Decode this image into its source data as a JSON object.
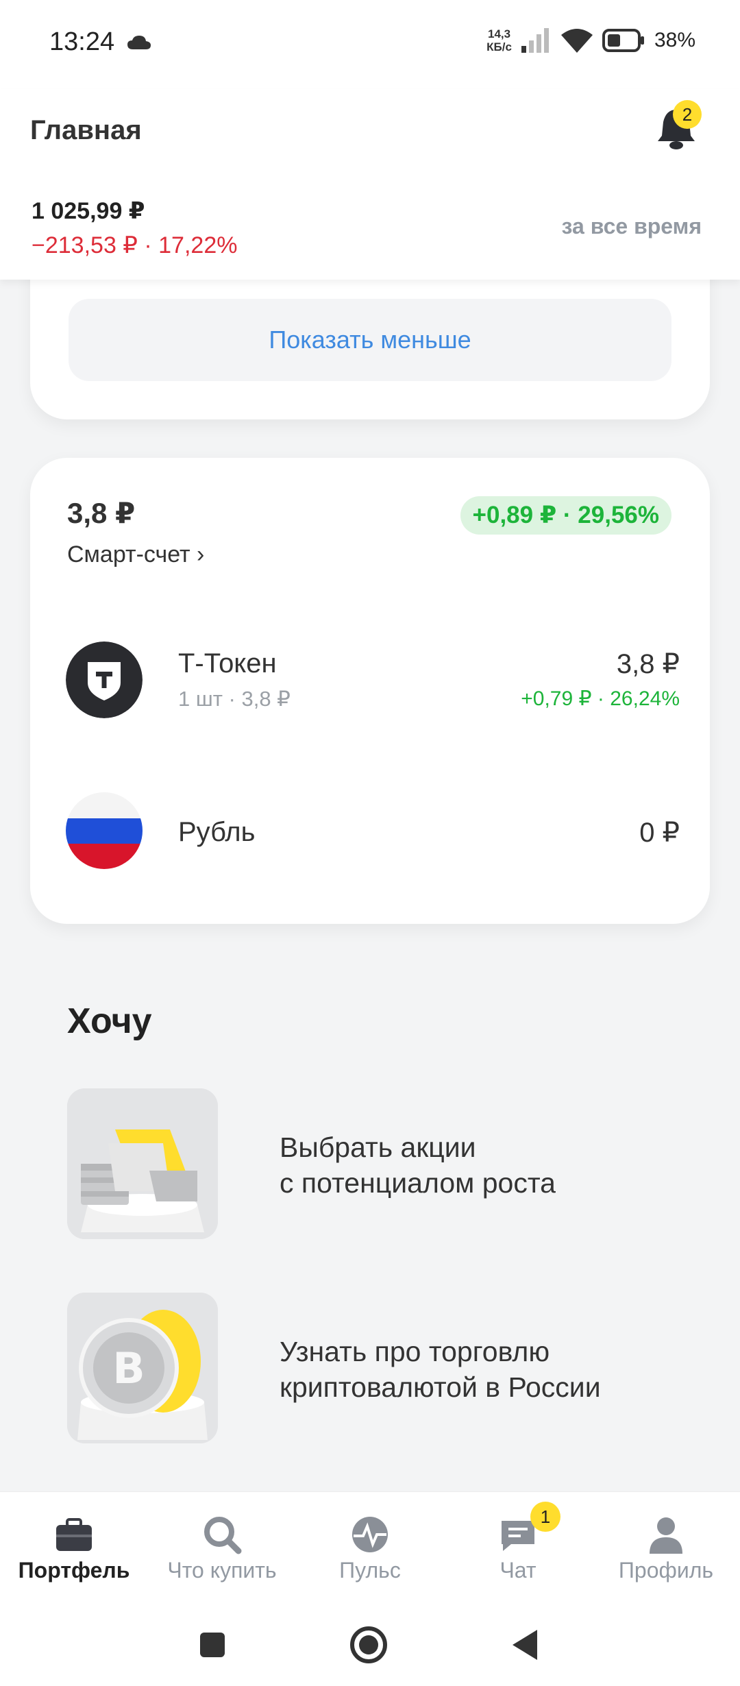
{
  "status_bar": {
    "time": "13:24",
    "net_speed_value": "14,3",
    "net_speed_unit": "КБ/с",
    "battery": "38%"
  },
  "header": {
    "title": "Главная",
    "notifications_count": "2",
    "balance": "1 025,99  ₽",
    "change": "−213,53 ₽ · 17,22%",
    "period": "за все время"
  },
  "show_less_label": "Показать меньше",
  "smart_account": {
    "amount": "3,8 ₽",
    "label": "Смарт-счет ›",
    "change": "+0,89 ₽ · 29,56%",
    "assets": [
      {
        "name": "Т-Токен",
        "sub": "1 шт · 3,8 ₽",
        "value": "3,8 ₽",
        "change": "+0,79 ₽ · 26,24%",
        "icon": "t-token-icon"
      },
      {
        "name": "Рубль",
        "sub": "",
        "value": "0 ₽",
        "change": "",
        "icon": "russia-flag-icon"
      }
    ]
  },
  "want": {
    "title": "Хочу",
    "items": [
      {
        "line1": "Выбрать акции",
        "line2": "с потенциалом роста"
      },
      {
        "line1": "Узнать про торговлю",
        "line2": "криптовалютой в России"
      }
    ]
  },
  "bottom_nav": {
    "items": [
      {
        "label": "Портфель",
        "icon": "briefcase-icon",
        "active": true
      },
      {
        "label": "Что купить",
        "icon": "search-icon",
        "active": false
      },
      {
        "label": "Пульс",
        "icon": "pulse-icon",
        "active": false
      },
      {
        "label": "Чат",
        "icon": "chat-icon",
        "active": false,
        "badge": "1"
      },
      {
        "label": "Профиль",
        "icon": "profile-icon",
        "active": false
      }
    ]
  },
  "colors": {
    "accent_yellow": "#ffdd2d",
    "negative": "#dd2c38",
    "positive": "#1db43a",
    "link": "#3f8ae0"
  }
}
